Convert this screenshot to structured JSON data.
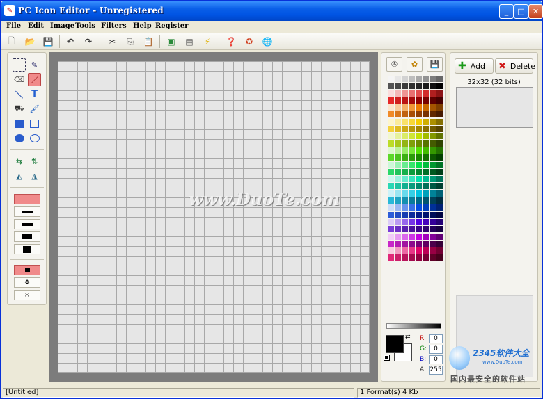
{
  "window": {
    "title": "PC Icon Editor - Unregistered"
  },
  "menu": [
    "File",
    "Edit",
    "Image",
    "Tools",
    "Filters",
    "Help",
    "Register"
  ],
  "toolbar_icons": [
    "new-icon",
    "open-icon",
    "save-icon",
    "undo-icon",
    "redo-icon",
    "cut-icon",
    "copy-icon",
    "paste-icon",
    "image-icon",
    "scanner-icon",
    "lightning-icon",
    "help-icon",
    "award-icon",
    "globe-icon"
  ],
  "tools": [
    "select-icon",
    "pencil-icon",
    "eraser-icon",
    "brush-icon",
    "line-icon",
    "text-icon",
    "fill-icon",
    "color-brush-icon",
    "filled-rect-icon",
    "rect-icon",
    "filled-ellipse-icon",
    "ellipse-icon",
    "flip-horizontal-icon",
    "flip-vertical-icon",
    "rotate-left-icon",
    "rotate-right-icon"
  ],
  "watermark": "www.DuoTe.com",
  "color": {
    "r_label": "R:",
    "g_label": "G:",
    "b_label": "B:",
    "a_label": "A:",
    "r": "0",
    "g": "0",
    "b": "0",
    "a": "255",
    "foreground": "#000000",
    "background": "#ffffff"
  },
  "icon_panel": {
    "add_label": "Add",
    "delete_label": "Delete",
    "format_label": "32x32  (32 bits)"
  },
  "status": {
    "file": "[Untitled]",
    "info": "1 Format(s) 4 Kb"
  },
  "logo": {
    "brand": "2345软件大全",
    "url": "www.DuoTe.com",
    "slogan": "国内最安全的软件站"
  },
  "palette_rows": [
    [
      "#f4f4f4",
      "#e6e6e6",
      "#d2d2d2",
      "#bdbdbd",
      "#a8a8a8",
      "#929292",
      "#7d7d7d",
      "#686868"
    ],
    [
      "#545454",
      "#474747",
      "#3b3b3b",
      "#303030",
      "#252525",
      "#1a1a1a",
      "#101010",
      "#000000"
    ],
    [
      "#fadcdc",
      "#f4b8b8",
      "#ee9494",
      "#e87070",
      "#e24c4c",
      "#d22b2b",
      "#b01f1f",
      "#8c1414"
    ],
    [
      "#e62828",
      "#d01e1e",
      "#ba1414",
      "#a40a0a",
      "#8e0000",
      "#760000",
      "#5e0000",
      "#460000"
    ],
    [
      "#fce4cc",
      "#f8ca9a",
      "#f4b068",
      "#f09636",
      "#ec7c04",
      "#c86800",
      "#a45400",
      "#804000"
    ],
    [
      "#f08a28",
      "#d8761c",
      "#c06210",
      "#a84e04",
      "#903e00",
      "#783200",
      "#602800",
      "#481c00"
    ],
    [
      "#fdf5cc",
      "#fbeb9a",
      "#f9e168",
      "#f7d736",
      "#f5cd04",
      "#d0ae00",
      "#ab8f00",
      "#867000"
    ],
    [
      "#f4d23c",
      "#e0bc22",
      "#ccaa14",
      "#b89808",
      "#a48600",
      "#8a7000",
      "#705a00",
      "#564400"
    ],
    [
      "#f2f8cc",
      "#e6f29a",
      "#daec68",
      "#cee636",
      "#c2e004",
      "#a2bc00",
      "#829800",
      "#627400"
    ],
    [
      "#bcdc28",
      "#a8c81e",
      "#94b414",
      "#80a00a",
      "#6c8c00",
      "#587400",
      "#445c00",
      "#304400"
    ],
    [
      "#dcf8cc",
      "#baf29a",
      "#98ec68",
      "#76e636",
      "#54e004",
      "#44bc00",
      "#349800",
      "#247400"
    ],
    [
      "#5cd828",
      "#4cc41e",
      "#3cb014",
      "#2c9c0a",
      "#1c8800",
      "#147000",
      "#0c5800",
      "#044000"
    ],
    [
      "#ccf8d8",
      "#9af2b4",
      "#68ec90",
      "#36e66c",
      "#04e048",
      "#00bc3c",
      "#009830",
      "#007424"
    ],
    [
      "#2ad868",
      "#20c45a",
      "#16b04c",
      "#0c9c3e",
      "#028830",
      "#007028",
      "#005820",
      "#004018"
    ],
    [
      "#ccf8ee",
      "#9af2de",
      "#68ecce",
      "#36e6be",
      "#04e0ae",
      "#00bc92",
      "#009876",
      "#00745a"
    ],
    [
      "#28d8b4",
      "#1ec4a2",
      "#14b090",
      "#0a9c7e",
      "#00886c",
      "#007058",
      "#005844",
      "#004030"
    ],
    [
      "#ccf2f8",
      "#9ae6f2",
      "#68daec",
      "#36cee6",
      "#04c2e0",
      "#00a2bc",
      "#008298",
      "#006274"
    ],
    [
      "#28b8d8",
      "#1ea4c4",
      "#1490b0",
      "#0a7c9c",
      "#006888",
      "#005470",
      "#004058",
      "#002c40"
    ],
    [
      "#ccdcf8",
      "#9ab8f2",
      "#6894ec",
      "#3670e6",
      "#044ce0",
      "#003ebc",
      "#003098",
      "#002274"
    ],
    [
      "#2c5cd8",
      "#224cc4",
      "#183cb0",
      "#0e2c9c",
      "#041c88",
      "#001470",
      "#000c58",
      "#000440"
    ],
    [
      "#dcccf8",
      "#ba9af2",
      "#9868ec",
      "#7636e6",
      "#5404e0",
      "#4400bc",
      "#340098",
      "#240074"
    ],
    [
      "#7a3cd8",
      "#6a2ec4",
      "#5a20b0",
      "#4a129c",
      "#3a0488",
      "#2e0070",
      "#220058",
      "#160040"
    ],
    [
      "#f2ccf8",
      "#e69af2",
      "#da68ec",
      "#ce36e6",
      "#c204e0",
      "#a200bc",
      "#820098",
      "#620074"
    ],
    [
      "#c828c8",
      "#b41eb4",
      "#a014a0",
      "#8c0a8c",
      "#780078",
      "#620062",
      "#4c004c",
      "#360036"
    ],
    [
      "#f8cce0",
      "#f29ac2",
      "#ec68a4",
      "#e63686",
      "#e00468",
      "#bc0056",
      "#980044",
      "#740032"
    ],
    [
      "#e02878",
      "#cc1e6a",
      "#b8145c",
      "#a40a4e",
      "#900040",
      "#780034",
      "#600028",
      "#48001c"
    ]
  ]
}
